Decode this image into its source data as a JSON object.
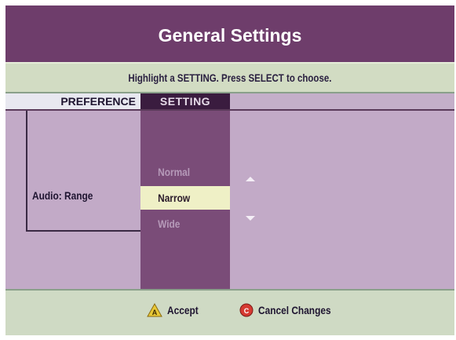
{
  "title": "General Settings",
  "instruction": "Highlight a SETTING. Press SELECT to choose.",
  "columns": {
    "preference": "PREFERENCE",
    "setting": "SETTING"
  },
  "preference_label": "Audio: Range",
  "options": [
    "Normal",
    "Narrow",
    "Wide"
  ],
  "selected_option": "Narrow",
  "footer": {
    "accept_label": "Accept",
    "cancel_label": "Cancel Changes"
  },
  "icons": {
    "accept": "a-triangle-icon",
    "cancel": "c-circle-icon",
    "up": "arrow-up-icon",
    "down": "arrow-down-icon"
  },
  "colors": {
    "title_bg": "#6e3d6b",
    "panel_bg": "#c2aac7",
    "setting_col": "#7a4c78",
    "selection": "#eff0c6",
    "accept_icon": "#e8c836",
    "cancel_icon": "#d63a32"
  }
}
